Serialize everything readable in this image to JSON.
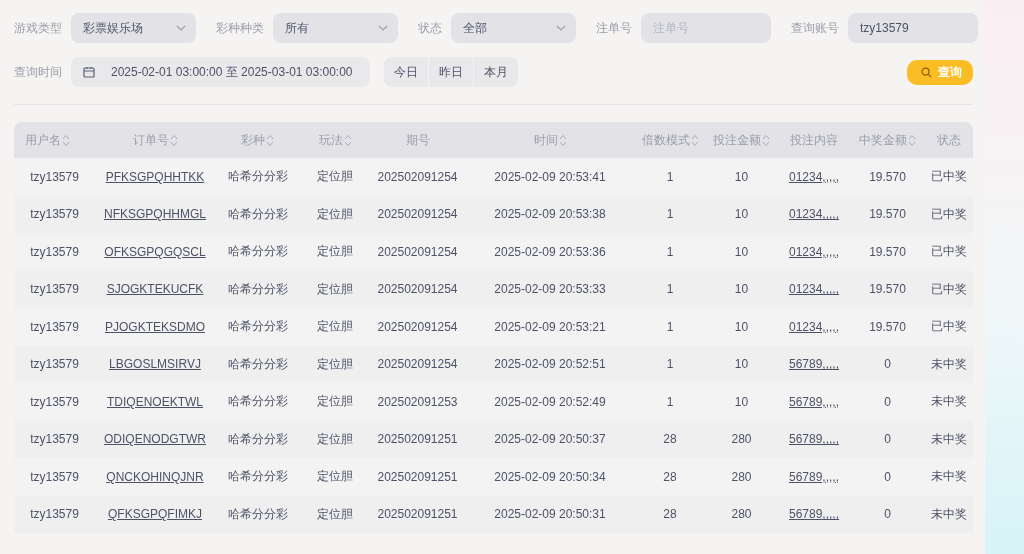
{
  "filters": [
    {
      "label": "游戏类型",
      "kind": "select",
      "value": "彩票娱乐场"
    },
    {
      "label": "彩种种类",
      "kind": "select",
      "value": "所有"
    },
    {
      "label": "状态",
      "kind": "select",
      "value": "全部"
    },
    {
      "label": "注单号",
      "kind": "input",
      "placeholder": "注单号"
    },
    {
      "label": "查询账号",
      "kind": "input",
      "value": "tzy13579"
    }
  ],
  "time_filter": {
    "label": "查询时间",
    "value": "2025-02-01 03:00:00 至 2025-03-01 03:00:00",
    "quick_buttons": [
      "今日",
      "昨日",
      "本月"
    ]
  },
  "search_button": "查询",
  "table": {
    "columns": [
      {
        "label": "用户名",
        "sortable": true
      },
      {
        "label": "订单号",
        "sortable": true
      },
      {
        "label": "彩种",
        "sortable": true
      },
      {
        "label": "玩法",
        "sortable": true
      },
      {
        "label": "期号",
        "sortable": false
      },
      {
        "label": "时间",
        "sortable": true
      },
      {
        "label": "倍数模式",
        "sortable": true
      },
      {
        "label": "投注金额",
        "sortable": true
      },
      {
        "label": "投注内容",
        "sortable": false
      },
      {
        "label": "中奖金额",
        "sortable": true
      },
      {
        "label": "状态",
        "sortable": false
      }
    ],
    "rows": [
      {
        "user": "tzy13579",
        "order": "PFKSGPQHHTKK",
        "lottery": "哈希分分彩",
        "play": "定位胆",
        "issue": "202502091254",
        "time": "2025-02-09 20:53:41",
        "multiple": "1",
        "amount": "10",
        "content": "01234,,,,,",
        "prize": "19.570",
        "status": "已中奖"
      },
      {
        "user": "tzy13579",
        "order": "NFKSGPQHHMGL",
        "lottery": "哈希分分彩",
        "play": "定位胆",
        "issue": "202502091254",
        "time": "2025-02-09 20:53:38",
        "multiple": "1",
        "amount": "10",
        "content": "01234,,,,,",
        "prize": "19.570",
        "status": "已中奖"
      },
      {
        "user": "tzy13579",
        "order": "OFKSGPQGQSCL",
        "lottery": "哈希分分彩",
        "play": "定位胆",
        "issue": "202502091254",
        "time": "2025-02-09 20:53:36",
        "multiple": "1",
        "amount": "10",
        "content": "01234,,,,,",
        "prize": "19.570",
        "status": "已中奖"
      },
      {
        "user": "tzy13579",
        "order": "SJOGKTEKUCFK",
        "lottery": "哈希分分彩",
        "play": "定位胆",
        "issue": "202502091254",
        "time": "2025-02-09 20:53:33",
        "multiple": "1",
        "amount": "10",
        "content": "01234,,,,,",
        "prize": "19.570",
        "status": "已中奖"
      },
      {
        "user": "tzy13579",
        "order": "PJOGKTEKSDMO",
        "lottery": "哈希分分彩",
        "play": "定位胆",
        "issue": "202502091254",
        "time": "2025-02-09 20:53:21",
        "multiple": "1",
        "amount": "10",
        "content": "01234,,,,,",
        "prize": "19.570",
        "status": "已中奖"
      },
      {
        "user": "tzy13579",
        "order": "LBGOSLMSIRVJ",
        "lottery": "哈希分分彩",
        "play": "定位胆",
        "issue": "202502091254",
        "time": "2025-02-09 20:52:51",
        "multiple": "1",
        "amount": "10",
        "content": "56789,,,,,",
        "prize": "0",
        "status": "未中奖"
      },
      {
        "user": "tzy13579",
        "order": "TDIQENOEKTWL",
        "lottery": "哈希分分彩",
        "play": "定位胆",
        "issue": "202502091253",
        "time": "2025-02-09 20:52:49",
        "multiple": "1",
        "amount": "10",
        "content": "56789,,,,,",
        "prize": "0",
        "status": "未中奖"
      },
      {
        "user": "tzy13579",
        "order": "ODIQENODGTWR",
        "lottery": "哈希分分彩",
        "play": "定位胆",
        "issue": "202502091251",
        "time": "2025-02-09 20:50:37",
        "multiple": "28",
        "amount": "280",
        "content": "56789,,,,,",
        "prize": "0",
        "status": "未中奖"
      },
      {
        "user": "tzy13579",
        "order": "QNCKOHINQJNR",
        "lottery": "哈希分分彩",
        "play": "定位胆",
        "issue": "202502091251",
        "time": "2025-02-09 20:50:34",
        "multiple": "28",
        "amount": "280",
        "content": "56789,,,,,",
        "prize": "0",
        "status": "未中奖"
      },
      {
        "user": "tzy13579",
        "order": "QFKSGPQFIMKJ",
        "lottery": "哈希分分彩",
        "play": "定位胆",
        "issue": "202502091251",
        "time": "2025-02-09 20:50:31",
        "multiple": "28",
        "amount": "280",
        "content": "56789,,,,,",
        "prize": "0",
        "status": "未中奖"
      }
    ]
  }
}
